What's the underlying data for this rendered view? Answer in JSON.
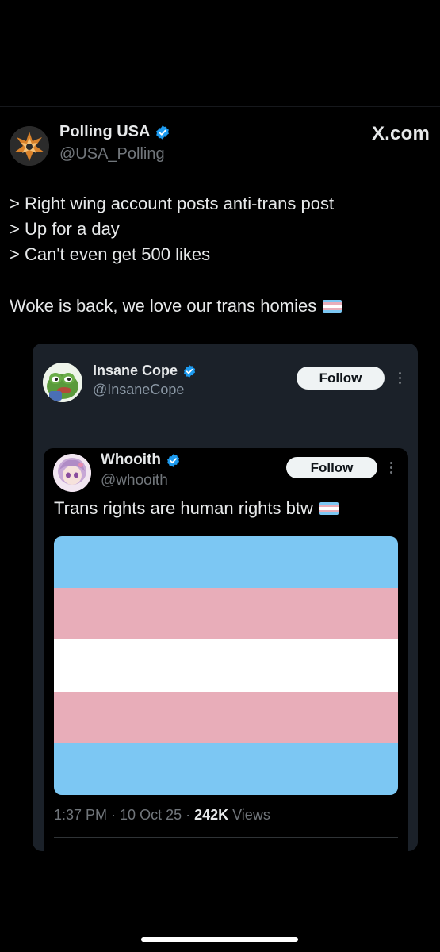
{
  "colors": {
    "background": "#000000",
    "card_background": "#1b2129",
    "verified_blue": "#1d9bf0",
    "trans_blue": "#7cc7f3",
    "trans_pink": "#e8adb9",
    "trans_white": "#ffffff"
  },
  "main_post": {
    "name": "Polling USA",
    "handle": "@USA_Polling",
    "avatar_icon": "polling-usa-logo",
    "site_label": "X.com",
    "lines": [
      "> Right wing account posts anti-trans post",
      "> Up for a day",
      "> Can't even get 500 likes"
    ],
    "closing": "Woke is back, we love our trans homies",
    "closing_emoji": "transgender-flag-emoji"
  },
  "outer_quote": {
    "name": "Insane Cope",
    "handle": "@InsaneCope",
    "avatar_icon": "pepe-frog-avatar",
    "follow_label": "Follow"
  },
  "inner_quote": {
    "name": "Whooith",
    "handle": "@whooith",
    "avatar_icon": "anime-character-avatar",
    "follow_label": "Follow",
    "text": "Trans rights are human rights btw",
    "text_emoji": "transgender-flag-emoji",
    "meta": {
      "time": "1:37 PM",
      "separator": " · ",
      "date": "10 Oct 25",
      "views_count": "242K",
      "views_label": " Views"
    }
  }
}
